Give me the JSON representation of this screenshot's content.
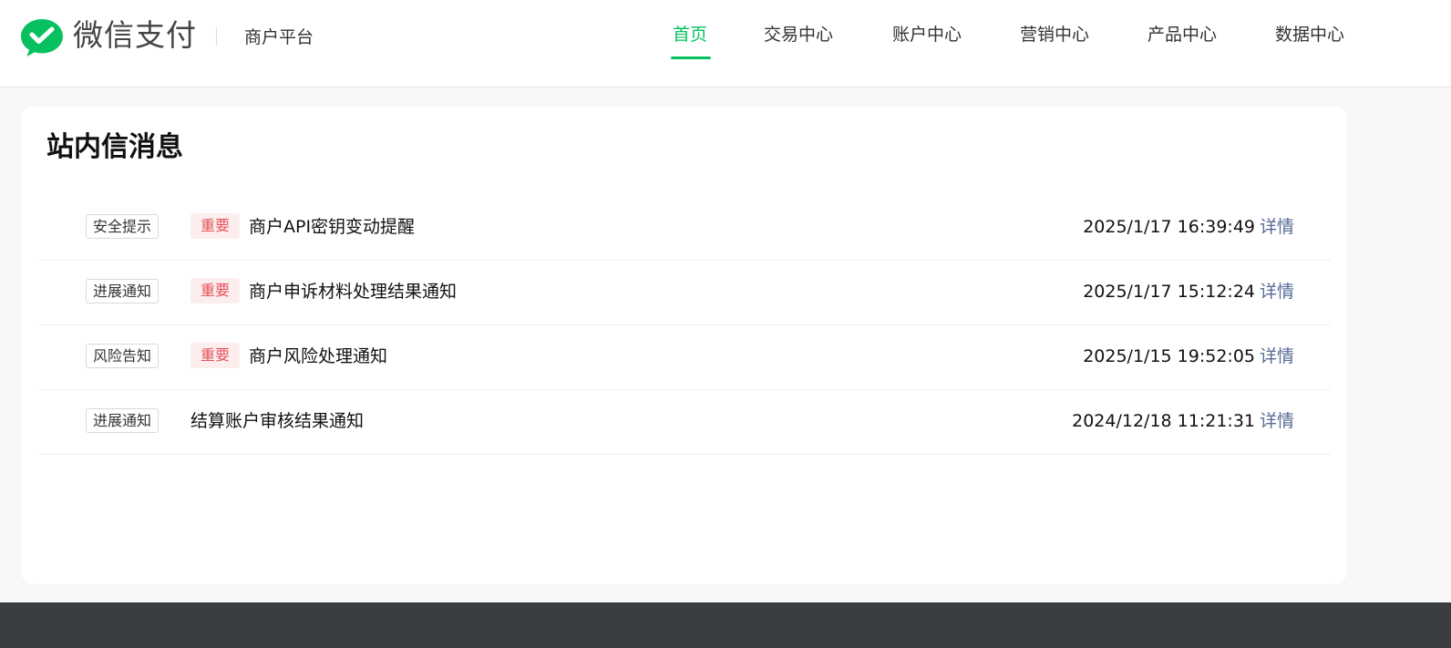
{
  "header": {
    "brand": "微信支付",
    "platform": "商户平台",
    "nav": [
      "首页",
      "交易中心",
      "账户中心",
      "营销中心",
      "产品中心",
      "数据中心"
    ],
    "active_index": 0
  },
  "colors": {
    "brand_green": "#07c160",
    "important_text": "#e5535c",
    "important_bg": "#fdeeee",
    "link": "#576b95",
    "footer": "#3b3e40"
  },
  "messages": {
    "title": "站内信消息",
    "items": [
      {
        "category": "安全提示",
        "badge": "重要",
        "title": "商户API密钥变动提醒",
        "time": "2025/1/17 16:39:49",
        "action": "详情"
      },
      {
        "category": "进展通知",
        "badge": "重要",
        "title": "商户申诉材料处理结果通知",
        "time": "2025/1/17 15:12:24",
        "action": "详情"
      },
      {
        "category": "风险告知",
        "badge": "重要",
        "title": "商户风险处理通知",
        "time": "2025/1/15 19:52:05",
        "action": "详情"
      },
      {
        "category": "进展通知",
        "badge": "",
        "title": "结算账户审核结果通知",
        "time": "2024/12/18 11:21:31",
        "action": "详情"
      }
    ]
  }
}
